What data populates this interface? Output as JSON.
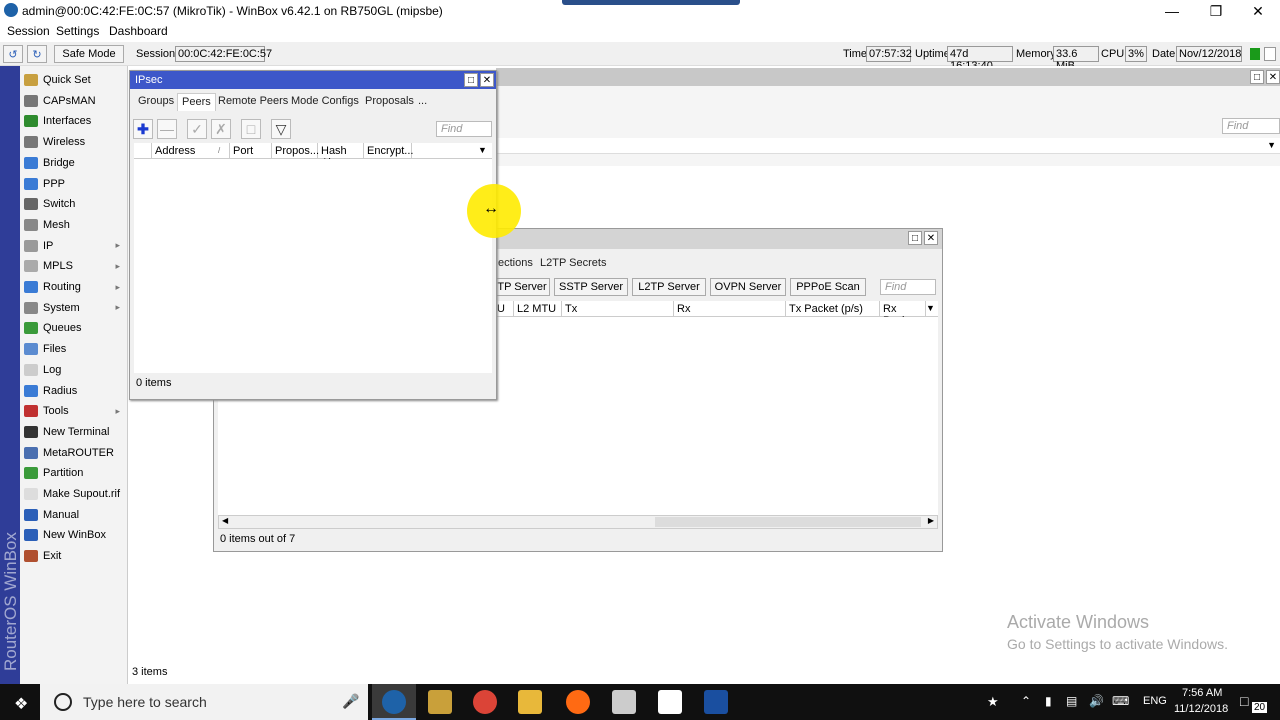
{
  "window": {
    "title": "admin@00:0C:42:FE:0C:57 (MikroTik) - WinBox v6.42.1 on RB750GL (mipsbe)"
  },
  "menu": [
    "Session",
    "Settings",
    "Dashboard"
  ],
  "toolbar": {
    "safe_mode": "Safe Mode",
    "session_label": "Session:",
    "session_value": "00:0C:42:FE:0C:57",
    "time_label": "Time:",
    "time_value": "07:57:32",
    "uptime_label": "Uptime:",
    "uptime_value": "47d 16:13:40",
    "memory_label": "Memory:",
    "memory_value": "33.6 MiB",
    "cpu_label": "CPU:",
    "cpu_value": "3%",
    "date_label": "Date:",
    "date_value": "Nov/12/2018"
  },
  "brand_vertical": "RouterOS WinBox",
  "sidebar": {
    "items": [
      {
        "label": "Quick Set",
        "color": "#c8a040",
        "arrow": false
      },
      {
        "label": "CAPsMAN",
        "color": "#777777",
        "arrow": false
      },
      {
        "label": "Interfaces",
        "color": "#2e8b2e",
        "arrow": false
      },
      {
        "label": "Wireless",
        "color": "#777777",
        "arrow": false
      },
      {
        "label": "Bridge",
        "color": "#3a7bd5",
        "arrow": false
      },
      {
        "label": "PPP",
        "color": "#3a7bd5",
        "arrow": false
      },
      {
        "label": "Switch",
        "color": "#666666",
        "arrow": false
      },
      {
        "label": "Mesh",
        "color": "#888888",
        "arrow": false
      },
      {
        "label": "IP",
        "color": "#999999",
        "arrow": true
      },
      {
        "label": "MPLS",
        "color": "#aaaaaa",
        "arrow": true
      },
      {
        "label": "Routing",
        "color": "#3a7bd5",
        "arrow": true
      },
      {
        "label": "System",
        "color": "#888888",
        "arrow": true
      },
      {
        "label": "Queues",
        "color": "#3a9a3a",
        "arrow": false
      },
      {
        "label": "Files",
        "color": "#5b8bd0",
        "arrow": false
      },
      {
        "label": "Log",
        "color": "#cccccc",
        "arrow": false
      },
      {
        "label": "Radius",
        "color": "#3a7bd5",
        "arrow": false
      },
      {
        "label": "Tools",
        "color": "#c03030",
        "arrow": true
      },
      {
        "label": "New Terminal",
        "color": "#333333",
        "arrow": false
      },
      {
        "label": "MetaROUTER",
        "color": "#4a6fb0",
        "arrow": false
      },
      {
        "label": "Partition",
        "color": "#3a9a3a",
        "arrow": false
      },
      {
        "label": "Make Supout.rif",
        "color": "#dddddd",
        "arrow": false
      },
      {
        "label": "Manual",
        "color": "#2b5fb8",
        "arrow": false
      },
      {
        "label": "New WinBox",
        "color": "#2b5fb8",
        "arrow": false
      },
      {
        "label": "Exit",
        "color": "#b05030",
        "arrow": false
      }
    ]
  },
  "back_window": {
    "find_placeholder": "Find",
    "status": "3 items"
  },
  "ppp_window": {
    "tabs": [
      "ections",
      "L2TP Secrets"
    ],
    "buttons": [
      "TP Server",
      "SSTP Server",
      "L2TP Server",
      "OVPN Server",
      "PPPoE Scan"
    ],
    "find_placeholder": "Find",
    "columns": [
      "U",
      "L2 MTU",
      "Tx",
      "Rx",
      "Tx Packet (p/s)",
      "Rx Pack"
    ],
    "status": "0 items out of 7"
  },
  "ipsec": {
    "title": "IPsec",
    "tabs": [
      "Groups",
      "Peers",
      "Remote Peers",
      "Mode Configs",
      "Proposals",
      "..."
    ],
    "active_tab": "Peers",
    "find_placeholder": "Find",
    "columns": [
      "Address",
      "Port",
      "Propos...",
      "Hash Al...",
      "Encrypt..."
    ],
    "status": "0 items"
  },
  "watermark": {
    "title": "Activate Windows",
    "subtitle": "Go to Settings to activate Windows."
  },
  "taskbar": {
    "search_placeholder": "Type here to search",
    "lang": "ENG",
    "time": "7:56 AM",
    "date": "11/12/2018",
    "notif_count": "20"
  }
}
